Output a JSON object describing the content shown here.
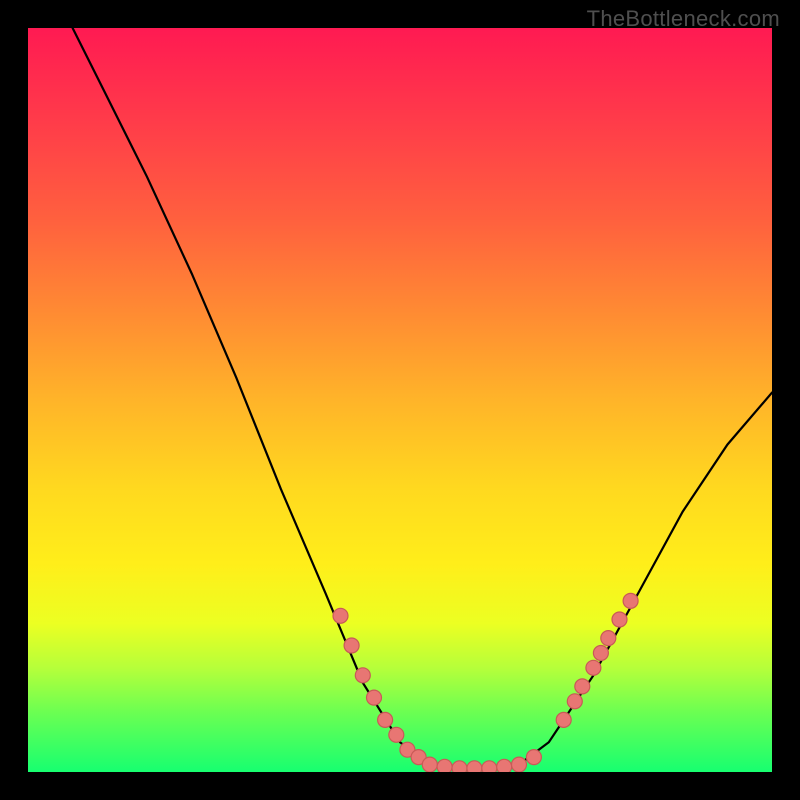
{
  "watermark": "TheBottleneck.com",
  "colors": {
    "frame": "#000000",
    "curve": "#000000",
    "dot_fill": "#e87673",
    "dot_stroke": "#c85a57",
    "gradient_stops": [
      "#ff1a52",
      "#ff3a4a",
      "#ff613e",
      "#ff8a33",
      "#ffb429",
      "#ffd91f",
      "#ffee1a",
      "#ecff22",
      "#b6ff3a",
      "#6bff52",
      "#17ff70"
    ]
  },
  "chart_data": {
    "type": "line",
    "title": "",
    "xlabel": "",
    "ylabel": "",
    "xlim": [
      0,
      100
    ],
    "ylim": [
      0,
      100
    ],
    "note": "Axes have no visible tick labels; values are positional estimates on a 0–100 scale matching the plot area.",
    "curve": [
      {
        "x": 6,
        "y": 100
      },
      {
        "x": 10,
        "y": 92
      },
      {
        "x": 16,
        "y": 80
      },
      {
        "x": 22,
        "y": 67
      },
      {
        "x": 28,
        "y": 53
      },
      {
        "x": 34,
        "y": 38
      },
      {
        "x": 40,
        "y": 24
      },
      {
        "x": 45,
        "y": 12
      },
      {
        "x": 50,
        "y": 4
      },
      {
        "x": 54,
        "y": 1
      },
      {
        "x": 58,
        "y": 0.5
      },
      {
        "x": 62,
        "y": 0.5
      },
      {
        "x": 66,
        "y": 1
      },
      {
        "x": 70,
        "y": 4
      },
      {
        "x": 76,
        "y": 13
      },
      {
        "x": 82,
        "y": 24
      },
      {
        "x": 88,
        "y": 35
      },
      {
        "x": 94,
        "y": 44
      },
      {
        "x": 100,
        "y": 51
      }
    ],
    "dots_left": [
      {
        "x": 42,
        "y": 21
      },
      {
        "x": 43.5,
        "y": 17
      },
      {
        "x": 45,
        "y": 13
      },
      {
        "x": 46.5,
        "y": 10
      },
      {
        "x": 48,
        "y": 7
      },
      {
        "x": 49.5,
        "y": 5
      },
      {
        "x": 51,
        "y": 3
      },
      {
        "x": 52.5,
        "y": 2
      }
    ],
    "dots_flat": [
      {
        "x": 54,
        "y": 1
      },
      {
        "x": 56,
        "y": 0.7
      },
      {
        "x": 58,
        "y": 0.5
      },
      {
        "x": 60,
        "y": 0.5
      },
      {
        "x": 62,
        "y": 0.5
      },
      {
        "x": 64,
        "y": 0.7
      },
      {
        "x": 66,
        "y": 1
      },
      {
        "x": 68,
        "y": 2
      }
    ],
    "dots_right": [
      {
        "x": 72,
        "y": 7
      },
      {
        "x": 73.5,
        "y": 9.5
      },
      {
        "x": 74.5,
        "y": 11.5
      },
      {
        "x": 76,
        "y": 14
      },
      {
        "x": 77,
        "y": 16
      },
      {
        "x": 78,
        "y": 18
      },
      {
        "x": 79.5,
        "y": 20.5
      },
      {
        "x": 81,
        "y": 23
      }
    ]
  }
}
